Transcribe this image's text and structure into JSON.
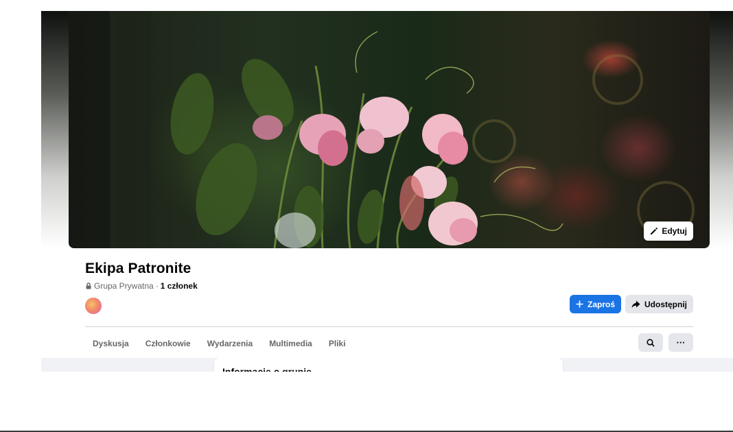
{
  "cover": {
    "edit_label": "Edytuj",
    "edit_icon": "pencil-icon"
  },
  "group": {
    "name": "Ekipa Patronite",
    "privacy": "Grupa Prywatna",
    "separator": "·",
    "members": "1 członek",
    "privacy_icon": "lock-icon"
  },
  "actions": {
    "invite_label": "Zaproś",
    "invite_icon": "plus-icon",
    "share_label": "Udostępnij",
    "share_icon": "share-icon"
  },
  "tabs": [
    {
      "label": "Dyskusja"
    },
    {
      "label": "Członkowie"
    },
    {
      "label": "Wydarzenia"
    },
    {
      "label": "Multimedia"
    },
    {
      "label": "Pliki"
    }
  ],
  "tab_actions": {
    "search_icon": "search-icon",
    "more_label": "···"
  },
  "info": {
    "title": "Informacje o grupie"
  },
  "colors": {
    "primary": "#1b74e4",
    "secondary_bg": "#e4e6eb",
    "muted_text": "#65676b",
    "feed_bg": "#f0f2f5"
  }
}
